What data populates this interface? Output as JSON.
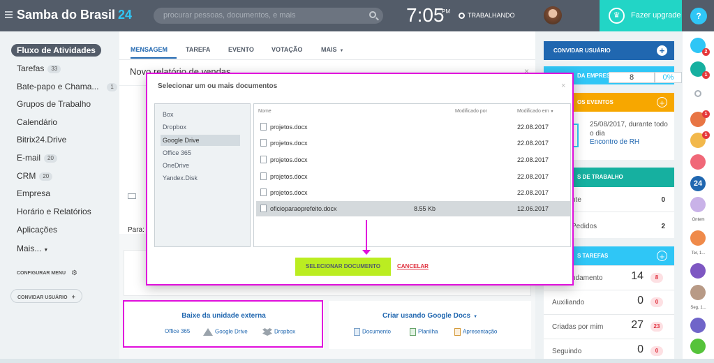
{
  "header": {
    "brand": "Samba do Brasil",
    "brand_suffix": "24",
    "search_placeholder": "procurar pessoas, documentos, e mais",
    "time": "7:05",
    "ampm": "PM",
    "status": "TRABALHANDO",
    "upgrade": "Fazer upgrade",
    "help": "?"
  },
  "sidebar": {
    "items": [
      {
        "label": "Fluxo de Atividades",
        "badge": ""
      },
      {
        "label": "Tarefas",
        "badge": "33"
      },
      {
        "label": "Bate-papo e Chama...",
        "badge": "1"
      },
      {
        "label": "Grupos de Trabalho",
        "badge": ""
      },
      {
        "label": "Calendário",
        "badge": ""
      },
      {
        "label": "Bitrix24.Drive",
        "badge": ""
      },
      {
        "label": "E-mail",
        "badge": "20"
      },
      {
        "label": "CRM",
        "badge": "20"
      },
      {
        "label": "Empresa",
        "badge": ""
      },
      {
        "label": "Horário e Relatórios",
        "badge": ""
      },
      {
        "label": "Aplicações",
        "badge": ""
      },
      {
        "label": "Mais...",
        "badge": ""
      }
    ],
    "configure": "CONFIGURAR MENU",
    "invite": "CONVIDAR USUÁRIO"
  },
  "composer": {
    "tabs": [
      "MENSAGEM",
      "TAREFA",
      "EVENTO",
      "VOTAÇÃO",
      "MAIS"
    ],
    "title": "Novo relatório de vendas",
    "to_label": "Para:"
  },
  "sources": {
    "external": {
      "title": "Baixe da unidade externa",
      "items": [
        "Office 365",
        "Google Drive",
        "Dropbox"
      ]
    },
    "gdocs": {
      "title": "Criar usando Google Docs",
      "items": [
        "Documento",
        "Planilha",
        "Apresentação"
      ]
    }
  },
  "dialog": {
    "title": "Selecionar um ou mais documentos",
    "sources": [
      "Box",
      "Dropbox",
      "Google Drive",
      "Office 365",
      "OneDrive",
      "Yandex.Disk"
    ],
    "selected_source": "Google Drive",
    "columns": {
      "name": "Nome",
      "modified_by": "Modificado por",
      "modified_at": "Modificado em"
    },
    "files": [
      {
        "name": "projetos.docx",
        "size": "",
        "date": "22.08.2017"
      },
      {
        "name": "projetos.docx",
        "size": "",
        "date": "22.08.2017"
      },
      {
        "name": "projetos.docx",
        "size": "",
        "date": "22.08.2017"
      },
      {
        "name": "projetos.docx",
        "size": "",
        "date": "22.08.2017"
      },
      {
        "name": "projetos.docx",
        "size": "",
        "date": "22.08.2017"
      },
      {
        "name": "oficioparaoprefeito.docx",
        "size": "8.55 Kb",
        "date": "12.06.2017"
      }
    ],
    "select_button": "SELECIONAR DOCUMENTO",
    "cancel": "CANCELAR"
  },
  "right": {
    "invite": "CONVIDAR USUÁRIO",
    "pulse_label": "DA EMPRESA",
    "pulse_value": "8",
    "pulse_pct": "0%",
    "events_title": "OS EVENTOS",
    "event_date": "25/08/2017, durante todo o dia",
    "event_name": "Encontro de RH",
    "groups_title": "S DE TRABALHO",
    "groups": [
      {
        "label": "nte",
        "value": "0"
      },
      {
        "label": "Pedidos",
        "value": "2"
      }
    ],
    "tasks_title": "S TAREFAS",
    "tasks": [
      {
        "label": "ndamento",
        "value": "14",
        "badge": "8"
      },
      {
        "label": "Auxiliando",
        "value": "0",
        "badge": "0"
      },
      {
        "label": "Criadas por mim",
        "value": "27",
        "badge": "23"
      },
      {
        "label": "Seguindo",
        "value": "0",
        "badge": "0"
      }
    ]
  },
  "farright": {
    "badges": [
      "2",
      "1",
      "1",
      "1"
    ],
    "avatar_labels": [
      "Ontem",
      "Ter, 1...",
      "Seg, 1..."
    ],
    "b24": "24"
  },
  "colors": {
    "topbar": "#535c69",
    "accent": "#2fc6f6",
    "upgrade": "#22d5c6",
    "highlight": "#e00fdc",
    "select_button": "#bbed21"
  }
}
